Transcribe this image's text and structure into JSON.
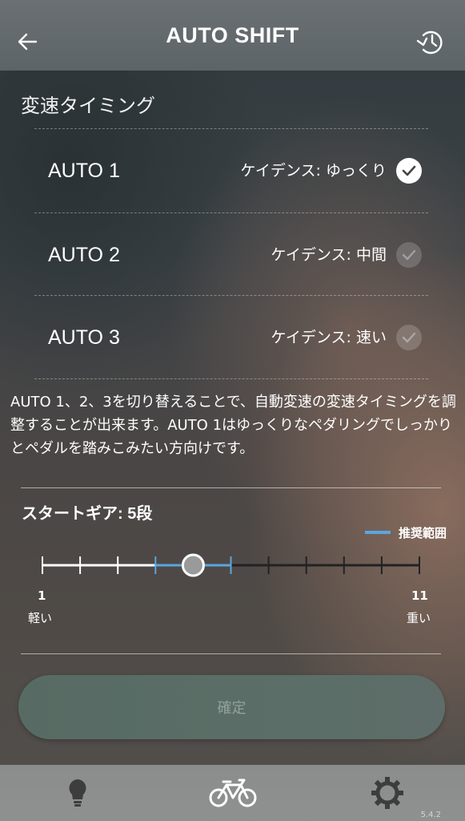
{
  "header": {
    "title": "AUTO SHIFT",
    "back_icon": "back-arrow-icon",
    "history_icon": "history-reset-icon"
  },
  "timing": {
    "title": "変速タイミング",
    "options": [
      {
        "label": "AUTO 1",
        "cadence": "ケイデンス: ゆっくり",
        "selected": true
      },
      {
        "label": "AUTO 2",
        "cadence": "ケイデンス: 中間",
        "selected": false
      },
      {
        "label": "AUTO 3",
        "cadence": "ケイデンス: 速い",
        "selected": false
      }
    ],
    "description": "AUTO 1、2、3を切り替えることで、自動変速の変速タイミングを調整することが出来ます。AUTO 1はゆっくりなペダリングでしっかりとペダルを踏みこみたい方向けです。"
  },
  "start_gear": {
    "title": "スタートギア: 5段",
    "legend": "推奨範囲",
    "min": 1,
    "max": 11,
    "value": 5,
    "recommended_range": [
      4,
      6
    ],
    "min_label": "1",
    "max_label": "11",
    "min_caption": "軽い",
    "max_caption": "重い"
  },
  "confirm_label": "確定",
  "tabbar": {
    "tabs": [
      {
        "icon": "lightbulb-icon",
        "active": false
      },
      {
        "icon": "bicycle-icon",
        "active": true
      },
      {
        "icon": "gear-icon",
        "active": false
      }
    ],
    "version": "5.4.2"
  },
  "colors": {
    "accent": "#5aa6e0",
    "filled_track": "#ffffff",
    "empty_track": "#222222"
  }
}
